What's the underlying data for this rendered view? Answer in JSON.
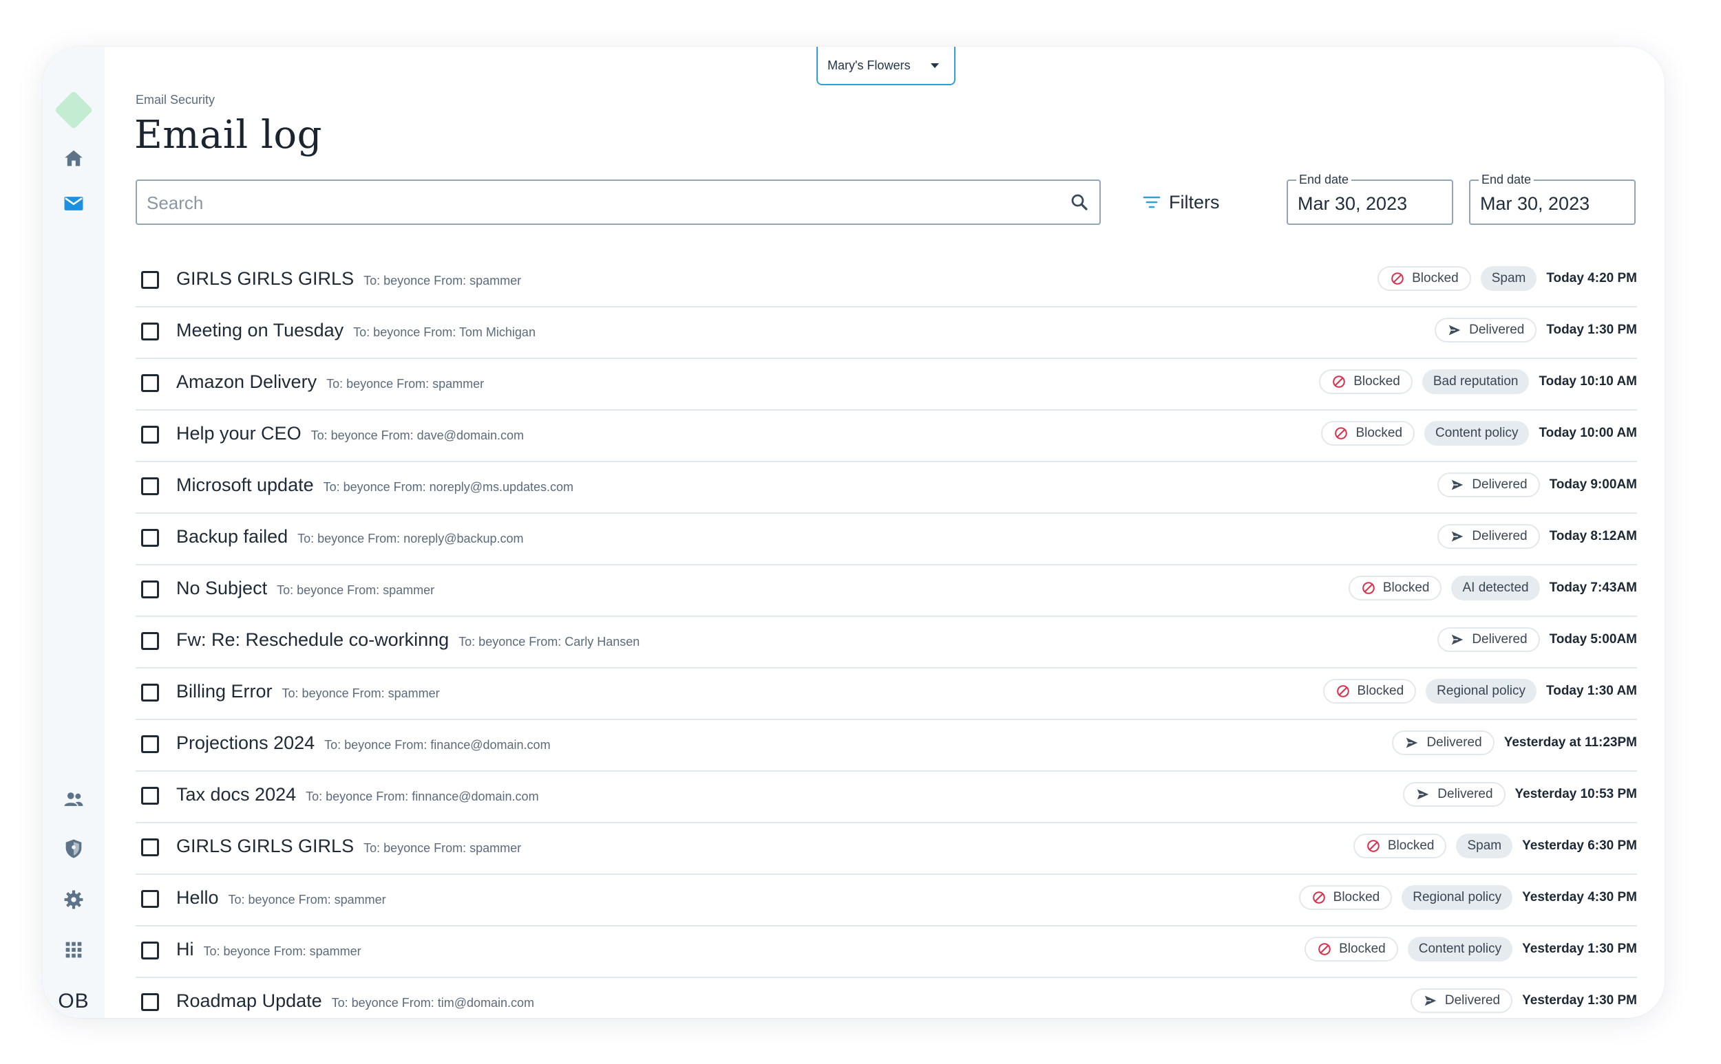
{
  "org_selector": {
    "label": "Mary's Flowers"
  },
  "breadcrumb": "Email Security",
  "title": "Email log",
  "search": {
    "placeholder": "Search",
    "value": ""
  },
  "filters_label": "Filters",
  "date_start": {
    "label": "End date",
    "value": "Mar 30, 2023"
  },
  "date_end": {
    "label": "End date",
    "value": "Mar 30, 2023"
  },
  "user_initials": "OB",
  "sidebar": [
    "home-icon",
    "mail-icon",
    "users-icon",
    "shield-icon",
    "gear-icon",
    "apps-grid-icon"
  ],
  "colors": {
    "accent": "#2f9fd8",
    "blocked_icon": "#d9304b",
    "sidebar_bg": "#f4f8fb",
    "logo": "#c3ecd2"
  },
  "emails": [
    {
      "subject": "GIRLS GIRLS GIRLS",
      "meta": "To: beyonce From: spammer",
      "status": "Blocked",
      "reason": "Spam",
      "time": "Today 4:20 PM"
    },
    {
      "subject": "Meeting on Tuesday",
      "meta": "To: beyonce From:  Tom Michigan",
      "status": "Delivered",
      "reason": "",
      "time": "Today 1:30 PM"
    },
    {
      "subject": "Amazon Delivery",
      "meta": "To: beyonce From: spammer",
      "status": "Blocked",
      "reason": "Bad reputation",
      "time": "Today 10:10 AM"
    },
    {
      "subject": "Help your CEO",
      "meta": "To: beyonce From: dave@domain.com",
      "status": "Blocked",
      "reason": "Content policy",
      "time": "Today 10:00 AM"
    },
    {
      "subject": "Microsoft update",
      "meta": "To: beyonce From: noreply@ms.updates.com",
      "status": "Delivered",
      "reason": "",
      "time": "Today 9:00AM"
    },
    {
      "subject": "Backup failed",
      "meta": "To: beyonce From: noreply@backup.com",
      "status": "Delivered",
      "reason": "",
      "time": "Today 8:12AM"
    },
    {
      "subject": "No Subject",
      "meta": "To: beyonce From: spammer",
      "status": "Blocked",
      "reason": "AI detected",
      "time": "Today 7:43AM"
    },
    {
      "subject": "Fw: Re: Reschedule co-workinng",
      "meta": "To: beyonce From: Carly Hansen",
      "status": "Delivered",
      "reason": "",
      "time": "Today 5:00AM"
    },
    {
      "subject": "Billing Error",
      "meta": "To: beyonce From: spammer",
      "status": "Blocked",
      "reason": "Regional policy",
      "time": "Today 1:30 AM"
    },
    {
      "subject": "Projections 2024",
      "meta": "To: beyonce From: finance@domain.com",
      "status": "Delivered",
      "reason": "",
      "time": "Yesterday at 11:23PM"
    },
    {
      "subject": "Tax docs 2024",
      "meta": "To: beyonce From: finnance@domain.com",
      "status": "Delivered",
      "reason": "",
      "time": "Yesterday 10:53 PM"
    },
    {
      "subject": "GIRLS GIRLS GIRLS",
      "meta": "To: beyonce From: spammer",
      "status": "Blocked",
      "reason": "Spam",
      "time": "Yesterday 6:30 PM"
    },
    {
      "subject": "Hello",
      "meta": "To: beyonce From: spammer",
      "status": "Blocked",
      "reason": "Regional policy",
      "time": "Yesterday 4:30 PM"
    },
    {
      "subject": "Hi",
      "meta": "To: beyonce From: spammer",
      "status": "Blocked",
      "reason": "Content policy",
      "time": "Yesterday 1:30 PM"
    },
    {
      "subject": "Roadmap Update",
      "meta": "To: beyonce From: tim@domain.com",
      "status": "Delivered",
      "reason": "",
      "time": "Yesterday 1:30 PM"
    }
  ]
}
